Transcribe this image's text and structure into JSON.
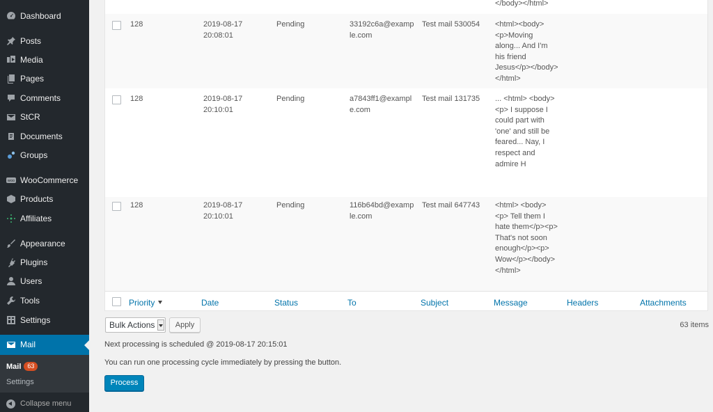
{
  "menu": {
    "items": [
      {
        "label": "Dashboard",
        "icon": "dashboard-icon"
      },
      {
        "label": "Posts",
        "icon": "pin-icon"
      },
      {
        "label": "Media",
        "icon": "media-icon"
      },
      {
        "label": "Pages",
        "icon": "pages-icon"
      },
      {
        "label": "Comments",
        "icon": "comment-icon"
      },
      {
        "label": "StCR",
        "icon": "mail-icon"
      },
      {
        "label": "Documents",
        "icon": "document-icon"
      },
      {
        "label": "Groups",
        "icon": "groups-icon"
      },
      {
        "label": "WooCommerce",
        "icon": "woo-icon"
      },
      {
        "label": "Products",
        "icon": "box-icon"
      },
      {
        "label": "Affiliates",
        "icon": "affiliates-icon"
      },
      {
        "label": "Appearance",
        "icon": "brush-icon"
      },
      {
        "label": "Plugins",
        "icon": "plugin-icon"
      },
      {
        "label": "Users",
        "icon": "user-icon"
      },
      {
        "label": "Tools",
        "icon": "wrench-icon"
      },
      {
        "label": "Settings",
        "icon": "settings-icon"
      },
      {
        "label": "Mail",
        "icon": "mail-icon"
      }
    ],
    "submenu": {
      "mail_label": "Mail",
      "mail_count": "63",
      "settings_label": "Settings"
    },
    "collapse_label": "Collapse menu"
  },
  "table": {
    "top_fragment": "</body></html>",
    "rows": [
      {
        "priority": "128",
        "date": "2019-08-17 20:08:01",
        "status": "Pending",
        "to": "33192c6a@example.com",
        "subject": "Test mail 530054",
        "message": "<html><body><p>Moving along... And I'm his friend Jesus</p></body></html>"
      },
      {
        "priority": "128",
        "date": "2019-08-17 20:10:01",
        "status": "Pending",
        "to": "a7843ff1@example.com",
        "subject": "Test mail 131735",
        "message": "...\n<html>\n<body><p> I suppose I could part with 'one' and still be feared... Nay, I respect and admire H"
      },
      {
        "priority": "128",
        "date": "2019-08-17 20:10:01",
        "status": "Pending",
        "to": "116b64bd@example.com",
        "subject": "Test mail 647743",
        "message": "<html>\n<body><p> Tell them I hate them</p><p> That's not soon enough</p><p> Wow</p></body></html>"
      }
    ],
    "footer": {
      "priority": "Priority",
      "date": "Date",
      "status": "Status",
      "to": "To",
      "subject": "Subject",
      "message": "Message",
      "headers": "Headers",
      "attachments": "Attachments"
    }
  },
  "controls": {
    "bulk_actions": "Bulk Actions",
    "apply": "Apply",
    "items_count": "63 items",
    "next_processing": "Next processing is scheduled @ 2019-08-17 20:15:01",
    "run_note": "You can run one processing cycle immediately by pressing the button.",
    "process": "Process"
  },
  "colors": {
    "sidebar": "#23282d",
    "accent": "#0073aa",
    "badge": "#d54e21",
    "button": "#0085ba"
  }
}
